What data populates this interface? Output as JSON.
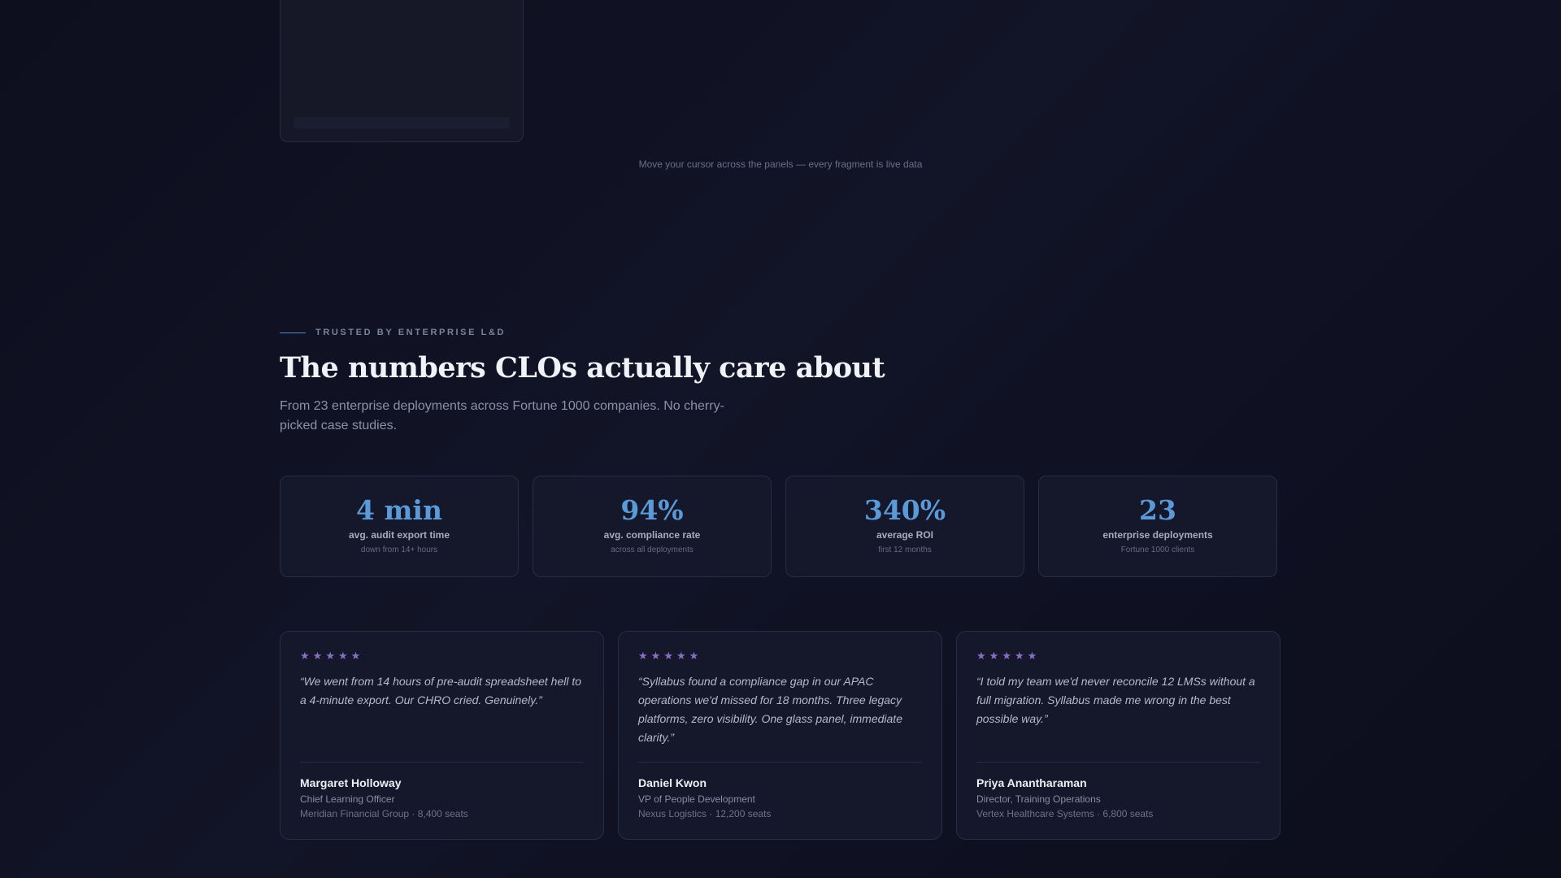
{
  "hint": "Move your cursor across the panels — every fragment is live data",
  "section": {
    "eyebrow": "TRUSTED BY ENTERPRISE L&D",
    "title": "The numbers CLOs actually care about",
    "lead": "From 23 enterprise deployments across Fortune 1000 companies. No cherry-picked case studies."
  },
  "stats": [
    {
      "value": "4 min",
      "label": "avg. audit export time",
      "sub": "down from 14+ hours"
    },
    {
      "value": "94%",
      "label": "avg. compliance rate",
      "sub": "across all deployments"
    },
    {
      "value": "340%",
      "label": "average ROI",
      "sub": "first 12 months"
    },
    {
      "value": "23",
      "label": "enterprise deployments",
      "sub": "Fortune 1000 clients"
    }
  ],
  "testimonials": [
    {
      "rating": 5,
      "quote": "“We went from 14 hours of pre-audit spreadsheet hell to a 4-minute export. Our CHRO cried. Genuinely.”",
      "name": "Margaret Holloway",
      "role": "Chief Learning Officer",
      "org": "Meridian Financial Group · 8,400 seats"
    },
    {
      "rating": 5,
      "quote": "“Syllabus found a compliance gap in our APAC operations we'd missed for 18 months. Three legacy platforms, zero visibility. One glass panel, immediate clarity.”",
      "name": "Daniel Kwon",
      "role": "VP of People Development",
      "org": "Nexus Logistics · 12,200 seats"
    },
    {
      "rating": 5,
      "quote": "“I told my team we'd never reconcile 12 LMSs without a full migration. Syllabus made me wrong in the best possible way.”",
      "name": "Priya Anantharaman",
      "role": "Director, Training Operations",
      "org": "Vertex Healthcare Systems · 6,800 seats"
    }
  ],
  "colors": {
    "accent": "#5b9ad8",
    "star": "#8a6fc7",
    "background": "#0e1020"
  },
  "icons": {
    "rating": "star-icon"
  }
}
